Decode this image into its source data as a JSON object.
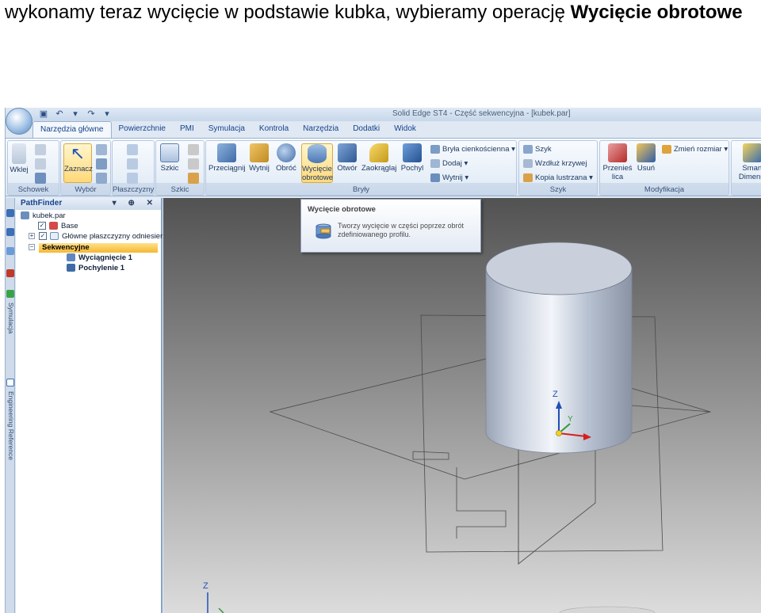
{
  "caption": {
    "text_before": "wykonamy teraz wycięcie w podstawie kubka, wybieramy operację ",
    "text_bold": "Wycięcie obrotowe"
  },
  "window": {
    "title": "Solid Edge ST4 - Część sekwencyjna - [kubek.par]"
  },
  "tabs": [
    {
      "label": "Narzędzia główne",
      "active": true
    },
    {
      "label": "Powierzchnie"
    },
    {
      "label": "PMI"
    },
    {
      "label": "Symulacja"
    },
    {
      "label": "Kontrola"
    },
    {
      "label": "Narzędzia"
    },
    {
      "label": "Dodatki"
    },
    {
      "label": "Widok"
    }
  ],
  "ribbon": {
    "groups": {
      "schowek": "Schowek",
      "wybor": "Wybór",
      "plaszczyzny": "Płaszczyzny",
      "szkic": "Szkic",
      "bryly": "Bryły",
      "szyk": "Szyk",
      "modyfikacja": "Modyfikacja"
    },
    "buttons": {
      "wklej": "Wklej",
      "zaznacz": "Zaznacz",
      "szkic": "Szkic",
      "przeciagnij": "Przeciągnij",
      "wytnij": "Wytnij",
      "obroc": "Obróć",
      "wyciecie_obrotowe_1": "Wycięcie",
      "wyciecie_obrotowe_2": "obrotowe",
      "otwor": "Otwór",
      "zaokraglaj": "Zaokrąglaj",
      "pochyl": "Pochyl",
      "bryla_cienkoscienna": "Bryła cienkościenna",
      "dodaj": "Dodaj",
      "wytnij_small": "Wytnij",
      "szyk": "Szyk",
      "wzdluz_krzywej": "Wzdłuż krzywej",
      "kopia_lustrzana": "Kopia lustrzana",
      "przenies_lica_1": "Przenieś",
      "przenies_lica_2": "lica",
      "usun": "Usuń",
      "zmien_rozmiar": "Zmień rozmiar",
      "smart_dim_1": "Smart",
      "smart_dim_2": "Dimensi"
    }
  },
  "left_strip": {
    "symulacja": "Symulacja",
    "engineering_reference": "Engineering Reference"
  },
  "pathfinder": {
    "title": "PathFinder",
    "header_buttons": "▾ ⊕ ✕",
    "items": {
      "root": "kubek.par",
      "base": "Base",
      "planes": "Główne płaszczyzny odniesier",
      "sequence": "Sekwencyjne",
      "feature1": "Wyciągnięcie 1",
      "feature2": "Pochylenie 1"
    }
  },
  "tooltip": {
    "title": "Wycięcie obrotowe",
    "description": "Tworzy wycięcie w części poprzez obrót zdefiniowanego profilu."
  },
  "triad": {
    "z": "Z",
    "y": "Y",
    "z_bottom": "Z"
  },
  "colors": {
    "ribbon_text": "#15428b",
    "selection": "#f5b733",
    "tooltip_border": "#8d9db4",
    "axis_z": "#1f4fb8",
    "axis_y": "#2f9a3a",
    "axis_x": "#d42020"
  }
}
